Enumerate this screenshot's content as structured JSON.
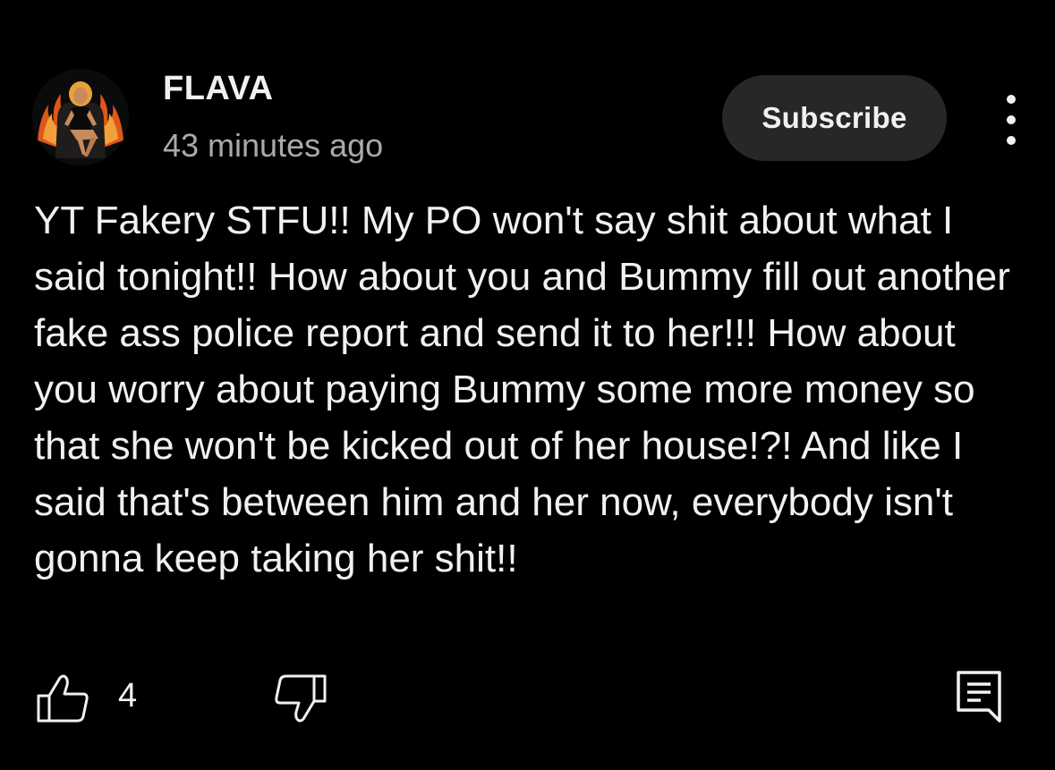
{
  "comment": {
    "author": "FLAVA",
    "timestamp": "43 minutes ago",
    "text": "YT Fakery STFU!! My PO won't say shit about what I said tonight!! How about you and Bummy fill out another fake ass police report and send it to her!!! How about you worry about paying Bummy some more money so that she won't be kicked out of her house!?! And like I said that's between him and her now, everybody isn't gonna keep taking her shit!!",
    "like_count": "4"
  },
  "actions": {
    "subscribe_label": "Subscribe"
  },
  "icons": {
    "more": "more-vertical-icon",
    "like": "thumbs-up-icon",
    "dislike": "thumbs-down-icon",
    "reply": "comment-reply-icon"
  },
  "colors": {
    "background": "#000000",
    "text_primary": "#f1f1f1",
    "text_secondary": "#aaaaaa",
    "button_bg": "#272727"
  }
}
